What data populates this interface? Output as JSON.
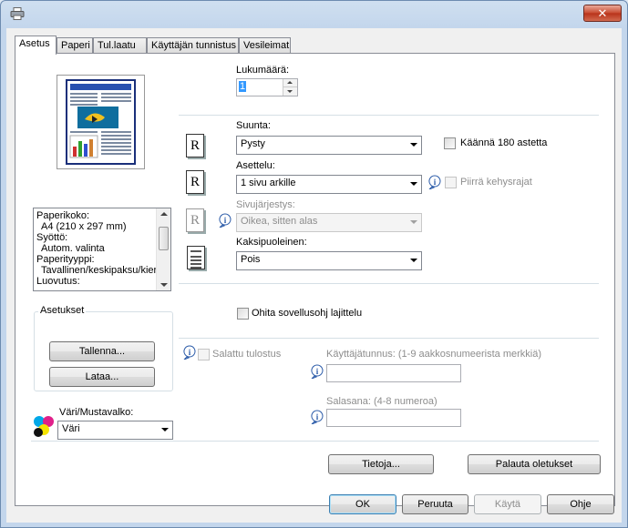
{
  "window": {
    "close_label": "✕",
    "icon": "printer-icon"
  },
  "tabs": [
    {
      "label": "Asetus"
    },
    {
      "label": "Paperi"
    },
    {
      "label": "Tul.laatu"
    },
    {
      "label": "Käyttäjän tunnistus"
    },
    {
      "label": "Vesileimat"
    }
  ],
  "preview": {
    "header_text": "PRINTFRESH",
    "icon": "page-preview-thumbnail"
  },
  "info_list": {
    "lines": [
      "Paperikoko:",
      "  A4 (210 x 297 mm)",
      "Syöttö:",
      "  Autom. valinta",
      "Paperityyppi:",
      "  Tavallinen/keskipaksu/kier",
      "Luovutus:"
    ]
  },
  "settings_group": {
    "title": "Asetukset",
    "save_label": "Tallenna...",
    "load_label": "Lataa..."
  },
  "color": {
    "label": "Väri/Mustavalko:",
    "value": "Väri",
    "icon": "color-dots-icon"
  },
  "copies": {
    "label": "Lukumäärä:",
    "value": "1"
  },
  "orientation": {
    "label": "Suunta:",
    "value": "Pysty",
    "rotate_label": "Käännä 180 astetta"
  },
  "layout": {
    "label": "Asettelu:",
    "value": "1 sivu arkille",
    "border_label": "Piirrä kehysrajat"
  },
  "page_order": {
    "label": "Sivujärjestys:",
    "value": "Oikea, sitten alas"
  },
  "duplex": {
    "label": "Kaksipuoleinen:",
    "value": "Pois"
  },
  "collate": {
    "label": "Ohita sovellusohj lajittelu"
  },
  "secure": {
    "label": "Salattu tulostus",
    "user_label": "Käyttäjätunnus: (1-9 aakkosnumeerista merkkiä)",
    "user_value": "",
    "password_label": "Salasana: (4-8 numeroa)",
    "password_value": ""
  },
  "panel_buttons": {
    "about_label": "Tietoja...",
    "defaults_label": "Palauta oletukset"
  },
  "dialog_buttons": {
    "ok_label": "OK",
    "cancel_label": "Peruuta",
    "apply_label": "Käytä",
    "help_label": "Ohje"
  }
}
